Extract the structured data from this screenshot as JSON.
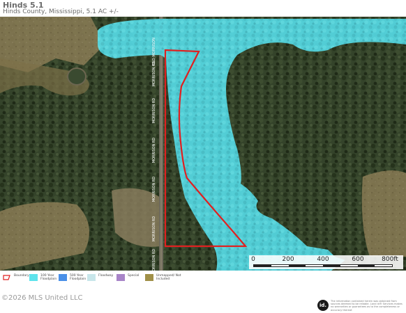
{
  "header": {
    "title": "Hinds 5.1",
    "subtitle": "Hinds County, Mississippi, 5.1 AC +/-"
  },
  "road_labels": [
    "OLD MORRISON",
    "MORRISON RD",
    "MORRISON RD",
    "MORRISON RD",
    "MORRISON RD",
    "MORRISON RD",
    "MORRISON RD"
  ],
  "scale": {
    "labels": [
      "0",
      "200",
      "400",
      "600",
      "800ft"
    ]
  },
  "legend": {
    "items": [
      {
        "key": "boundary",
        "label": "Boundary",
        "color": "#e02020"
      },
      {
        "key": "100yr",
        "label": "100 Year Floodplain",
        "color": "#5ee3ec"
      },
      {
        "key": "500yr",
        "label": "500 Year Floodplain",
        "color": "#4a90e8"
      },
      {
        "key": "floodway",
        "label": "Floodway",
        "color": "#c8e6ea"
      },
      {
        "key": "special",
        "label": "Special",
        "color": "#a884c8"
      },
      {
        "key": "unmapped",
        "label": "Unmapped/ Not Included",
        "color": "#a09048"
      }
    ]
  },
  "footer": {
    "copyright": "©2026 MLS United LLC",
    "logo_text": "id.",
    "disclaimer": "The information contained herein was obtained from sources deemed to be reliable. Land id® Services makes no warranties or guarantees as to the completeness or accuracy thereof."
  },
  "colors": {
    "floodplain": "#5ee3ec",
    "boundary": "#e02020",
    "forest": "#2c3a22",
    "field": "#8a7a4e"
  }
}
